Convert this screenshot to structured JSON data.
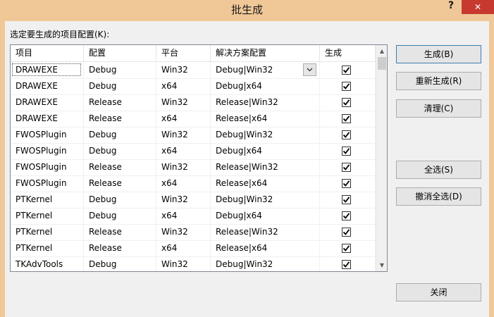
{
  "window": {
    "title": "批生成",
    "help": "?",
    "close": "✕"
  },
  "prompt": "选定要生成的项目配置(K):",
  "columns": [
    "项目",
    "配置",
    "平台",
    "解决方案配置",
    "生成"
  ],
  "rows": [
    {
      "project": "DRAWEXE",
      "config": "Debug",
      "platform": "Win32",
      "solution": "Debug|Win32",
      "build": true
    },
    {
      "project": "DRAWEXE",
      "config": "Debug",
      "platform": "x64",
      "solution": "Debug|x64",
      "build": true
    },
    {
      "project": "DRAWEXE",
      "config": "Release",
      "platform": "Win32",
      "solution": "Release|Win32",
      "build": true
    },
    {
      "project": "DRAWEXE",
      "config": "Release",
      "platform": "x64",
      "solution": "Release|x64",
      "build": true
    },
    {
      "project": "FWOSPlugin",
      "config": "Debug",
      "platform": "Win32",
      "solution": "Debug|Win32",
      "build": true
    },
    {
      "project": "FWOSPlugin",
      "config": "Debug",
      "platform": "x64",
      "solution": "Debug|x64",
      "build": true
    },
    {
      "project": "FWOSPlugin",
      "config": "Release",
      "platform": "Win32",
      "solution": "Release|Win32",
      "build": true
    },
    {
      "project": "FWOSPlugin",
      "config": "Release",
      "platform": "x64",
      "solution": "Release|x64",
      "build": true
    },
    {
      "project": "PTKernel",
      "config": "Debug",
      "platform": "Win32",
      "solution": "Debug|Win32",
      "build": true
    },
    {
      "project": "PTKernel",
      "config": "Debug",
      "platform": "x64",
      "solution": "Debug|x64",
      "build": true
    },
    {
      "project": "PTKernel",
      "config": "Release",
      "platform": "Win32",
      "solution": "Release|Win32",
      "build": true
    },
    {
      "project": "PTKernel",
      "config": "Release",
      "platform": "x64",
      "solution": "Release|x64",
      "build": true
    },
    {
      "project": "TKAdvTools",
      "config": "Debug",
      "platform": "Win32",
      "solution": "Debug|Win32",
      "build": true
    }
  ],
  "buttons": {
    "build": "生成(B)",
    "rebuild": "重新生成(R)",
    "clean": "清理(C)",
    "select_all": "全选(S)",
    "deselect_all": "撤消全选(D)",
    "close": "关闭"
  },
  "colors": {
    "title_bar": "#f0c898",
    "close_button": "#c7392e"
  }
}
